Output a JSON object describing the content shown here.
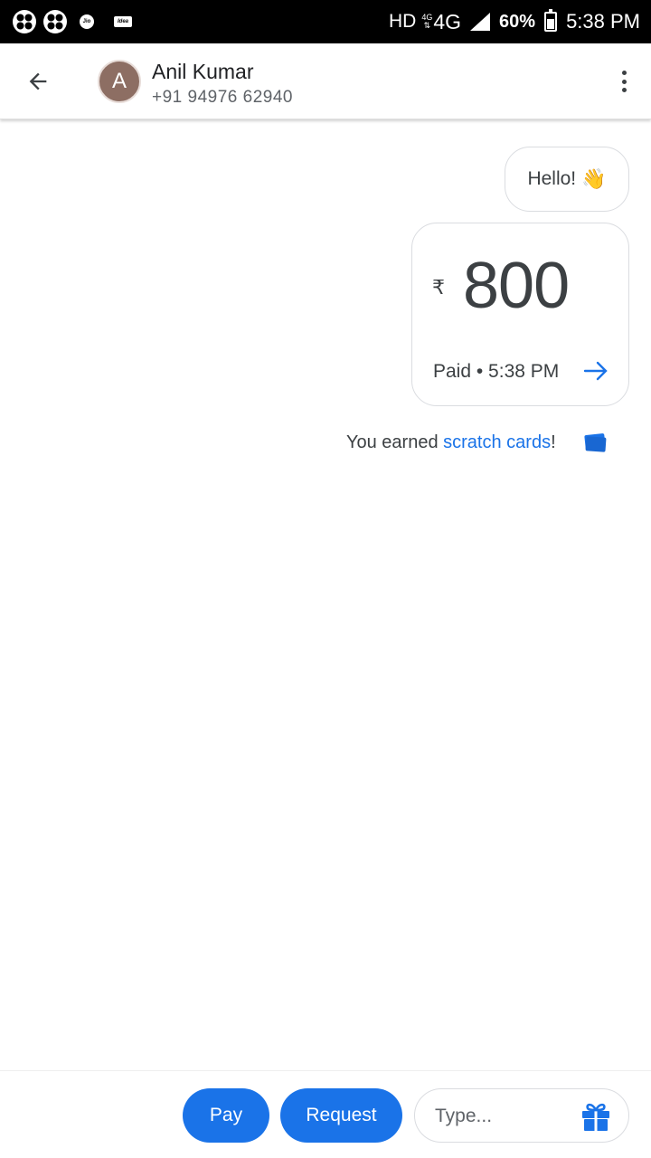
{
  "status_bar": {
    "carrier1": "Jio",
    "carrier2": "Idea",
    "hd": "HD",
    "network_small": "4G",
    "network": "4G",
    "battery": "60%",
    "battery_level": 0.6,
    "time": "5:38 PM"
  },
  "header": {
    "avatar_letter": "A",
    "contact_name": "Anil Kumar",
    "contact_phone": "+91 94976 62940",
    "back_icon": "arrow-back-icon",
    "menu_icon": "more-vert-icon"
  },
  "messages": {
    "greeting": "Hello!",
    "greeting_emoji": "👋"
  },
  "payment": {
    "currency": "₹",
    "amount": "800",
    "status": "Paid • 5:38 PM"
  },
  "reward": {
    "prefix": "You earned ",
    "link": "scratch cards",
    "suffix": "!"
  },
  "bottom_bar": {
    "pay_label": "Pay",
    "request_label": "Request",
    "type_placeholder": "Type...",
    "gift_icon": "gift-icon"
  },
  "colors": {
    "accent": "#1a73e8",
    "avatar": "#8d6e63",
    "text": "#3c4043"
  }
}
